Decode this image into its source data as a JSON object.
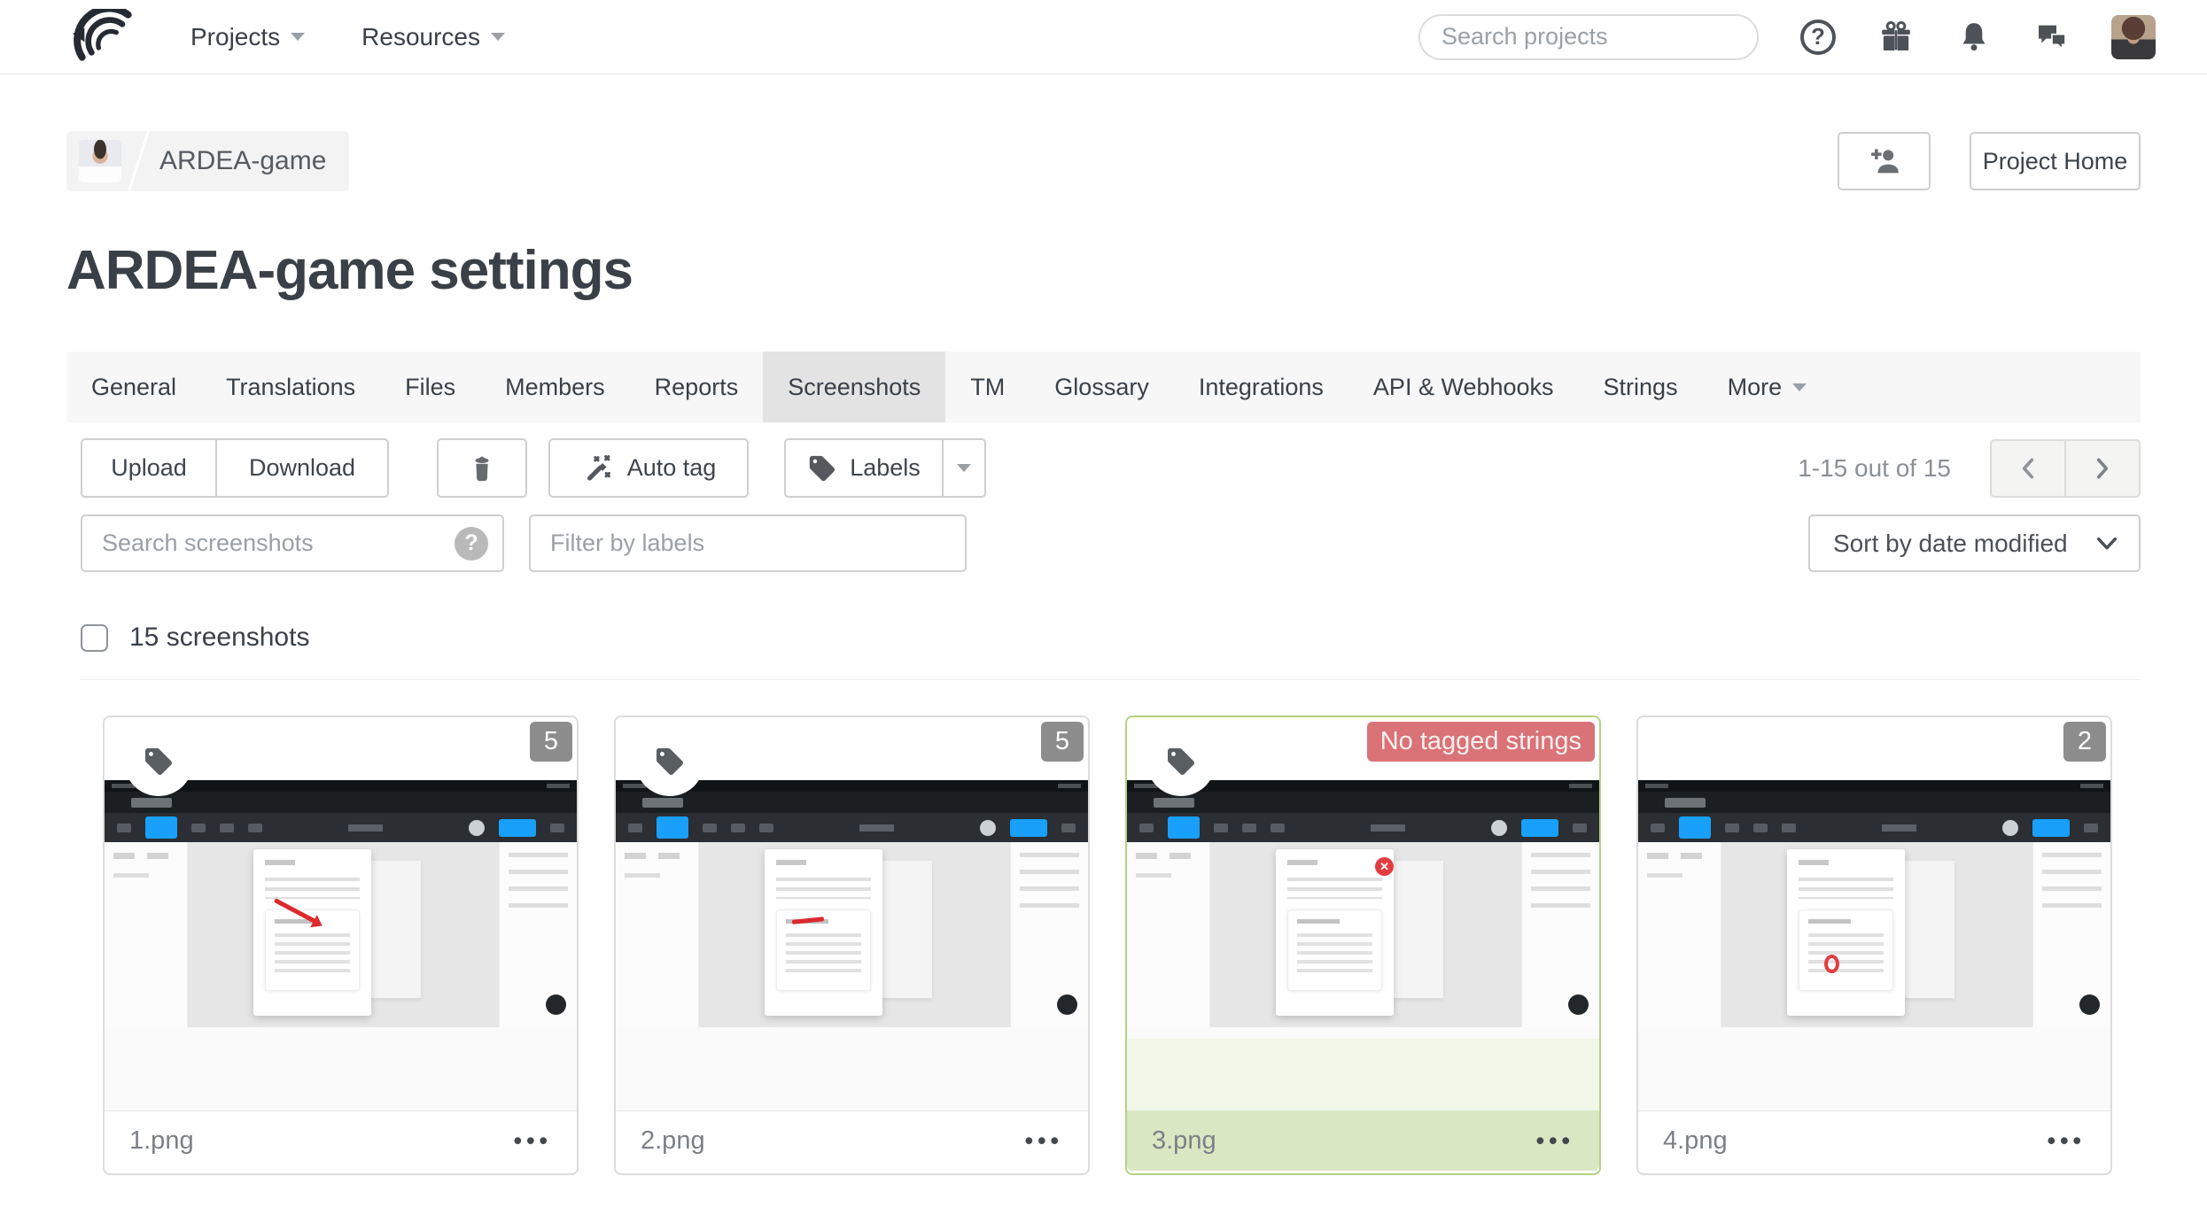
{
  "header": {
    "nav": [
      {
        "label": "Projects"
      },
      {
        "label": "Resources"
      }
    ],
    "search": {
      "placeholder": "Search projects"
    },
    "icons": {
      "help": "question-circle",
      "gifts": "gift-box",
      "notifications": "bell",
      "messages": "chat-bubbles",
      "account": "user-avatar"
    }
  },
  "breadcrumb": {
    "project": "ARDEA-game"
  },
  "page": {
    "title": "ARDEA-game settings"
  },
  "header_actions": {
    "project_home": "Project Home"
  },
  "tabs": {
    "active": "Screenshots",
    "items": [
      {
        "label": "General"
      },
      {
        "label": "Translations"
      },
      {
        "label": "Files"
      },
      {
        "label": "Members"
      },
      {
        "label": "Reports"
      },
      {
        "label": "Screenshots"
      },
      {
        "label": "TM"
      },
      {
        "label": "Glossary"
      },
      {
        "label": "Integrations"
      },
      {
        "label": "API & Webhooks"
      },
      {
        "label": "Strings"
      },
      {
        "label": "More",
        "caret": true
      }
    ]
  },
  "toolbar": {
    "upload": "Upload",
    "download": "Download",
    "auto_tag": "Auto tag",
    "labels": "Labels",
    "range": "1-15 out of 15"
  },
  "filters": {
    "search_placeholder": "Search screenshots",
    "help_badge": "?",
    "labels_placeholder": "Filter by labels",
    "sort_value": "Sort by date modified"
  },
  "selection": {
    "count_label": "15 screenshots",
    "checked": false
  },
  "cards_meta": {
    "menu_icon": "•••"
  },
  "cards": [
    {
      "name": "1.png",
      "badge": "5",
      "badge_type": "count",
      "selected": false,
      "tag_icon": true,
      "annotation": "red-arrow"
    },
    {
      "name": "2.png",
      "badge": "5",
      "badge_type": "count",
      "selected": false,
      "tag_icon": true,
      "annotation": "red-underline"
    },
    {
      "name": "3.png",
      "badge": "No tagged strings",
      "badge_type": "warning",
      "selected": true,
      "tag_icon": true,
      "annotation": "red-close"
    },
    {
      "name": "4.png",
      "badge": "2",
      "badge_type": "count",
      "selected": false,
      "tag_icon": false,
      "annotation": "red-circle"
    }
  ],
  "colors": {
    "accent_blue": "#18a0fb",
    "selected_green_border": "#b2d284",
    "selected_green_bg": "#d9e7c3",
    "warning_red": "#d97377",
    "badge_gray": "#8d8d8d"
  }
}
